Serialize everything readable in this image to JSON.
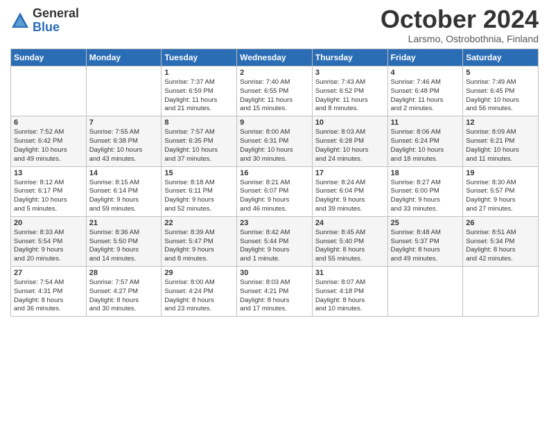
{
  "logo": {
    "general": "General",
    "blue": "Blue"
  },
  "title": "October 2024",
  "location": "Larsmo, Ostrobothnia, Finland",
  "headers": [
    "Sunday",
    "Monday",
    "Tuesday",
    "Wednesday",
    "Thursday",
    "Friday",
    "Saturday"
  ],
  "weeks": [
    [
      {
        "day": "",
        "text": ""
      },
      {
        "day": "",
        "text": ""
      },
      {
        "day": "1",
        "text": "Sunrise: 7:37 AM\nSunset: 6:59 PM\nDaylight: 11 hours\nand 21 minutes."
      },
      {
        "day": "2",
        "text": "Sunrise: 7:40 AM\nSunset: 6:55 PM\nDaylight: 11 hours\nand 15 minutes."
      },
      {
        "day": "3",
        "text": "Sunrise: 7:43 AM\nSunset: 6:52 PM\nDaylight: 11 hours\nand 8 minutes."
      },
      {
        "day": "4",
        "text": "Sunrise: 7:46 AM\nSunset: 6:48 PM\nDaylight: 11 hours\nand 2 minutes."
      },
      {
        "day": "5",
        "text": "Sunrise: 7:49 AM\nSunset: 6:45 PM\nDaylight: 10 hours\nand 56 minutes."
      }
    ],
    [
      {
        "day": "6",
        "text": "Sunrise: 7:52 AM\nSunset: 6:42 PM\nDaylight: 10 hours\nand 49 minutes."
      },
      {
        "day": "7",
        "text": "Sunrise: 7:55 AM\nSunset: 6:38 PM\nDaylight: 10 hours\nand 43 minutes."
      },
      {
        "day": "8",
        "text": "Sunrise: 7:57 AM\nSunset: 6:35 PM\nDaylight: 10 hours\nand 37 minutes."
      },
      {
        "day": "9",
        "text": "Sunrise: 8:00 AM\nSunset: 6:31 PM\nDaylight: 10 hours\nand 30 minutes."
      },
      {
        "day": "10",
        "text": "Sunrise: 8:03 AM\nSunset: 6:28 PM\nDaylight: 10 hours\nand 24 minutes."
      },
      {
        "day": "11",
        "text": "Sunrise: 8:06 AM\nSunset: 6:24 PM\nDaylight: 10 hours\nand 18 minutes."
      },
      {
        "day": "12",
        "text": "Sunrise: 8:09 AM\nSunset: 6:21 PM\nDaylight: 10 hours\nand 11 minutes."
      }
    ],
    [
      {
        "day": "13",
        "text": "Sunrise: 8:12 AM\nSunset: 6:17 PM\nDaylight: 10 hours\nand 5 minutes."
      },
      {
        "day": "14",
        "text": "Sunrise: 8:15 AM\nSunset: 6:14 PM\nDaylight: 9 hours\nand 59 minutes."
      },
      {
        "day": "15",
        "text": "Sunrise: 8:18 AM\nSunset: 6:11 PM\nDaylight: 9 hours\nand 52 minutes."
      },
      {
        "day": "16",
        "text": "Sunrise: 8:21 AM\nSunset: 6:07 PM\nDaylight: 9 hours\nand 46 minutes."
      },
      {
        "day": "17",
        "text": "Sunrise: 8:24 AM\nSunset: 6:04 PM\nDaylight: 9 hours\nand 39 minutes."
      },
      {
        "day": "18",
        "text": "Sunrise: 8:27 AM\nSunset: 6:00 PM\nDaylight: 9 hours\nand 33 minutes."
      },
      {
        "day": "19",
        "text": "Sunrise: 8:30 AM\nSunset: 5:57 PM\nDaylight: 9 hours\nand 27 minutes."
      }
    ],
    [
      {
        "day": "20",
        "text": "Sunrise: 8:33 AM\nSunset: 5:54 PM\nDaylight: 9 hours\nand 20 minutes."
      },
      {
        "day": "21",
        "text": "Sunrise: 8:36 AM\nSunset: 5:50 PM\nDaylight: 9 hours\nand 14 minutes."
      },
      {
        "day": "22",
        "text": "Sunrise: 8:39 AM\nSunset: 5:47 PM\nDaylight: 9 hours\nand 8 minutes."
      },
      {
        "day": "23",
        "text": "Sunrise: 8:42 AM\nSunset: 5:44 PM\nDaylight: 9 hours\nand 1 minute."
      },
      {
        "day": "24",
        "text": "Sunrise: 8:45 AM\nSunset: 5:40 PM\nDaylight: 8 hours\nand 55 minutes."
      },
      {
        "day": "25",
        "text": "Sunrise: 8:48 AM\nSunset: 5:37 PM\nDaylight: 8 hours\nand 49 minutes."
      },
      {
        "day": "26",
        "text": "Sunrise: 8:51 AM\nSunset: 5:34 PM\nDaylight: 8 hours\nand 42 minutes."
      }
    ],
    [
      {
        "day": "27",
        "text": "Sunrise: 7:54 AM\nSunset: 4:31 PM\nDaylight: 8 hours\nand 36 minutes."
      },
      {
        "day": "28",
        "text": "Sunrise: 7:57 AM\nSunset: 4:27 PM\nDaylight: 8 hours\nand 30 minutes."
      },
      {
        "day": "29",
        "text": "Sunrise: 8:00 AM\nSunset: 4:24 PM\nDaylight: 8 hours\nand 23 minutes."
      },
      {
        "day": "30",
        "text": "Sunrise: 8:03 AM\nSunset: 4:21 PM\nDaylight: 8 hours\nand 17 minutes."
      },
      {
        "day": "31",
        "text": "Sunrise: 8:07 AM\nSunset: 4:18 PM\nDaylight: 8 hours\nand 10 minutes."
      },
      {
        "day": "",
        "text": ""
      },
      {
        "day": "",
        "text": ""
      }
    ]
  ]
}
